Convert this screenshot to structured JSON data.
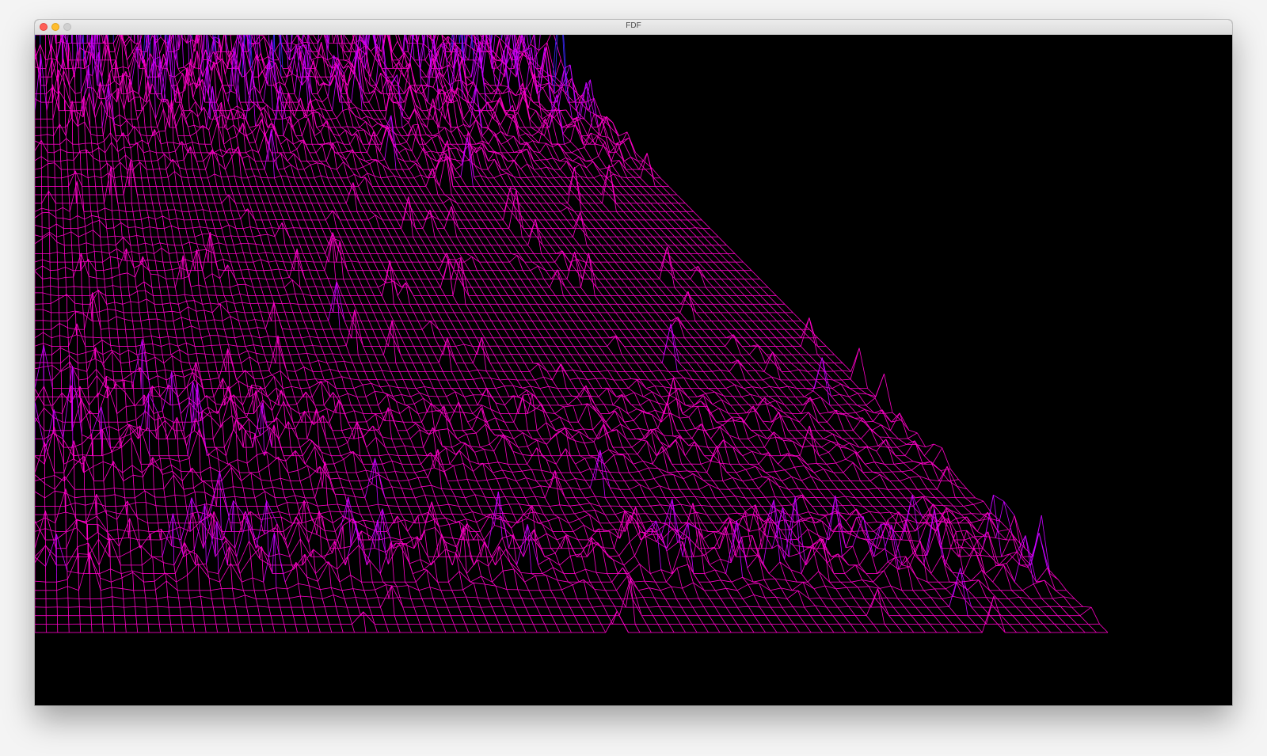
{
  "window": {
    "title": "FDF"
  },
  "controls": {
    "close": "close-window",
    "minimize": "minimize-window",
    "maximize": "maximize-window"
  },
  "render": {
    "background": "#000000",
    "line_color_low": "#ff00c8",
    "line_color_mid": "#c800ff",
    "line_color_high": "#3c28ff"
  }
}
